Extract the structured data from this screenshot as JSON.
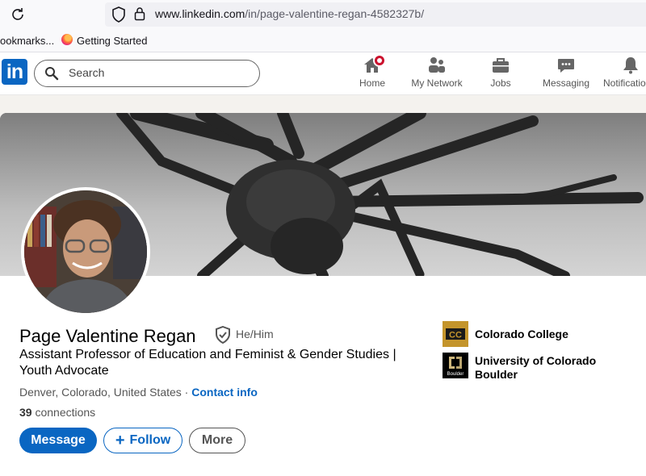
{
  "browser": {
    "url_host": "www.linkedin.com",
    "url_path": "/in/page-valentine-regan-4582327b/",
    "bookmarks": [
      {
        "label": "ookmarks..."
      },
      {
        "label": "Getting Started"
      }
    ]
  },
  "nav": {
    "search_placeholder": "Search",
    "items": [
      {
        "label": "Home",
        "icon": "home-icon"
      },
      {
        "label": "My Network",
        "icon": "network-icon"
      },
      {
        "label": "Jobs",
        "icon": "jobs-icon"
      },
      {
        "label": "Messaging",
        "icon": "messaging-icon"
      },
      {
        "label": "Notificatio",
        "icon": "bell-icon"
      }
    ]
  },
  "profile": {
    "name": "Page Valentine Regan",
    "pronouns": "He/Him",
    "headline": "Assistant Professor of Education and Feminist & Gender Studies | Youth Advocate",
    "location": "Denver, Colorado, United States",
    "separator": "·",
    "contact_info": "Contact info",
    "connections_count": "39",
    "connections_label": "connections",
    "buttons": {
      "message": "Message",
      "follow": "Follow",
      "more": "More"
    },
    "education": [
      {
        "name": "Colorado College",
        "logo_text": "CC"
      },
      {
        "name": "University of Colorado Boulder",
        "logo_text": "Boulder"
      }
    ]
  },
  "colors": {
    "brand": "#0a66c2",
    "badge": "#cb112d",
    "cc_logo": "#c4952c"
  }
}
